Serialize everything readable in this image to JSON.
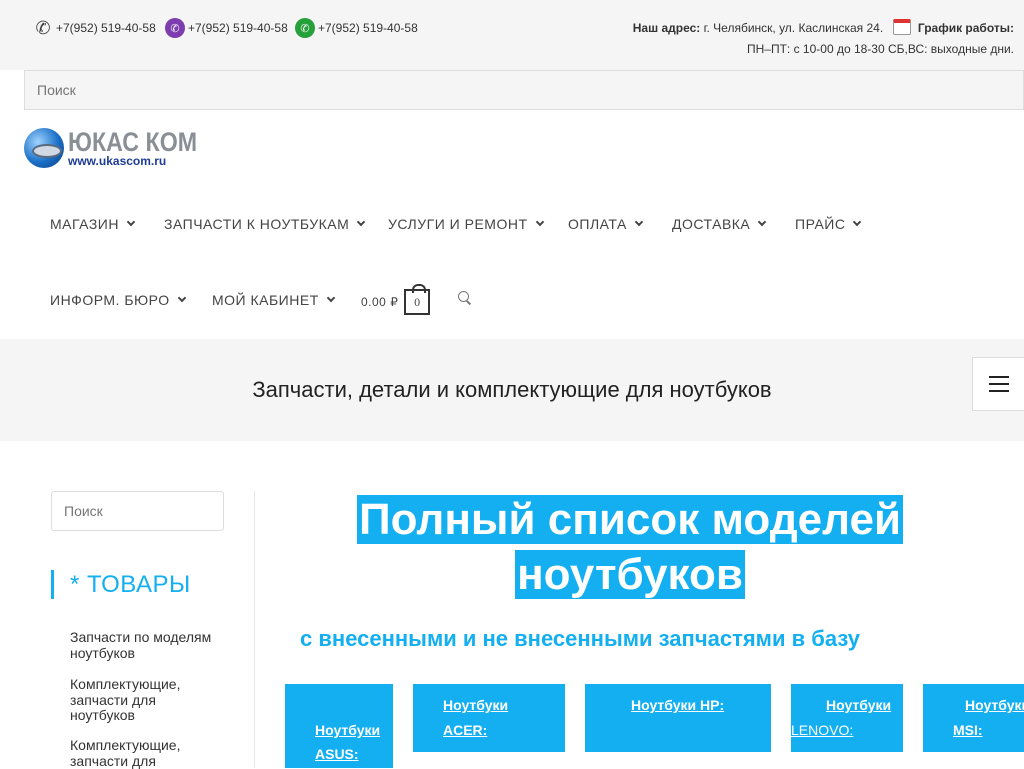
{
  "topbar": {
    "phones": [
      {
        "icon": "phone-icon",
        "text": "+7(952) 519-40-58"
      },
      {
        "icon": "viber-icon",
        "text": "+7(952) 519-40-58"
      },
      {
        "icon": "whatsapp-icon",
        "text": "+7(952) 519-40-58"
      }
    ],
    "address_label": "Наш адрес:",
    "address_value": "г. Челябинск, ул. Каслинская 24.",
    "schedule_label": "График работы:",
    "schedule_value": "ПН–ПТ: с 10-00 до 18-30 СБ,ВС: выходные дни."
  },
  "top_search": {
    "placeholder": "Поиск"
  },
  "logo": {
    "name": "ЮКАС КОМ",
    "url": "www.ukascom.ru"
  },
  "nav": {
    "items": [
      {
        "label": "МАГАЗИН"
      },
      {
        "label": "ЗАПЧАСТИ К НОУТБУКАМ"
      },
      {
        "label": "УСЛУГИ И РЕМОНТ"
      },
      {
        "label": "ОПЛАТА"
      },
      {
        "label": "ДОСТАВКА"
      },
      {
        "label": "ПРАЙС"
      },
      {
        "label": "ИНФОРМ. БЮРО"
      },
      {
        "label": "МОЙ КАБИНЕТ"
      }
    ],
    "cart_total": "0.00 ₽",
    "cart_count": "0"
  },
  "banner": {
    "title": "Запчасти, детали и комплектующие для ноутбуков"
  },
  "sidebar": {
    "search_placeholder": "Поиск",
    "title": "* ТОВАРЫ",
    "links": [
      {
        "label": "Запчасти по моделям ноутбуков"
      },
      {
        "label": "Комплектующие, запчасти  для ноутбуков"
      },
      {
        "label": "Комплектующие, запчасти  для"
      }
    ]
  },
  "main": {
    "title_line1": "Полный список моделей",
    "title_line2": "ноутбуков",
    "subtitle": "с внесенными и не внесенными запчастями в базу",
    "brands": [
      {
        "line1": "Ноутбуки",
        "line2": "ASUS:"
      },
      {
        "line1": "Ноутбуки",
        "line2": "ACER:"
      },
      {
        "line1": "Ноутбуки HP:"
      },
      {
        "line1": "Ноутбуки",
        "line2": "LENOVO:"
      },
      {
        "line1": "Ноутбуки",
        "line2": "MSI:"
      }
    ]
  },
  "colors": {
    "accent": "#13aff0",
    "topbar_bg": "#f5f5f5",
    "banner_bg": "#f5f5f5"
  }
}
